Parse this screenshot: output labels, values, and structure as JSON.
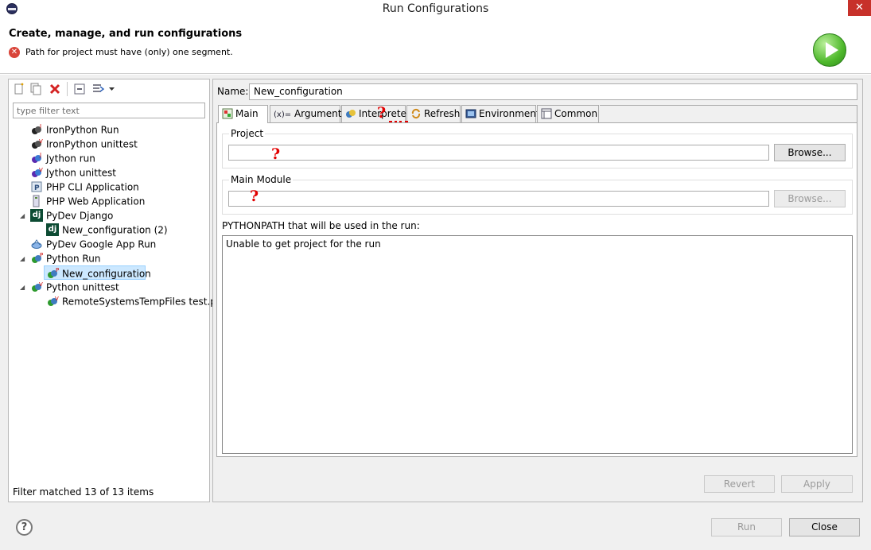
{
  "window": {
    "title": "Run Configurations",
    "close_glyph": "✕"
  },
  "header": {
    "title": "Create, manage, and run configurations",
    "error_glyph": "✕",
    "error_message": "Path for project must have (only) one segment."
  },
  "left": {
    "filter_placeholder": "type filter text",
    "tree": [
      {
        "label": "IronPython Run",
        "icon": "ironpython-run-icon"
      },
      {
        "label": "IronPython unittest",
        "icon": "ironpython-unittest-icon"
      },
      {
        "label": "Jython run",
        "icon": "jython-run-icon"
      },
      {
        "label": "Jython unittest",
        "icon": "jython-unittest-icon"
      },
      {
        "label": "PHP CLI Application",
        "icon": "php-cli-icon"
      },
      {
        "label": "PHP Web Application",
        "icon": "php-web-icon"
      },
      {
        "label": "PyDev Django",
        "icon": "django-icon",
        "dj": "dj"
      },
      {
        "label": "New_configuration (2)",
        "icon": "django-icon",
        "dj": "dj"
      },
      {
        "label": "PyDev Google App Run",
        "icon": "google-app-icon"
      },
      {
        "label": "Python Run",
        "icon": "python-run-icon"
      },
      {
        "label": "New_configuration",
        "icon": "python-run-icon"
      },
      {
        "label": "Python unittest",
        "icon": "python-unittest-icon"
      },
      {
        "label": "RemoteSystemsTempFiles test.py",
        "icon": "python-unittest-icon"
      }
    ],
    "filter_status": "Filter matched 13 of 13 items"
  },
  "right": {
    "name_label": "Name:",
    "name_value": "New_configuration",
    "tabs": [
      "Main",
      "Arguments",
      "Interpreter",
      "Refresh",
      "Environment",
      "Common"
    ],
    "arguments_glyph": "(x)=",
    "project_label": "Project",
    "main_module_label": "Main Module",
    "browse_label": "Browse...",
    "pythonpath_label": "PYTHONPATH that will be used in the run:",
    "pythonpath_value": "Unable to get project for the run",
    "revert_label": "Revert",
    "apply_label": "Apply",
    "question_mark": "?"
  },
  "footer": {
    "help_glyph": "?",
    "run_label": "Run",
    "close_label": "Close"
  }
}
